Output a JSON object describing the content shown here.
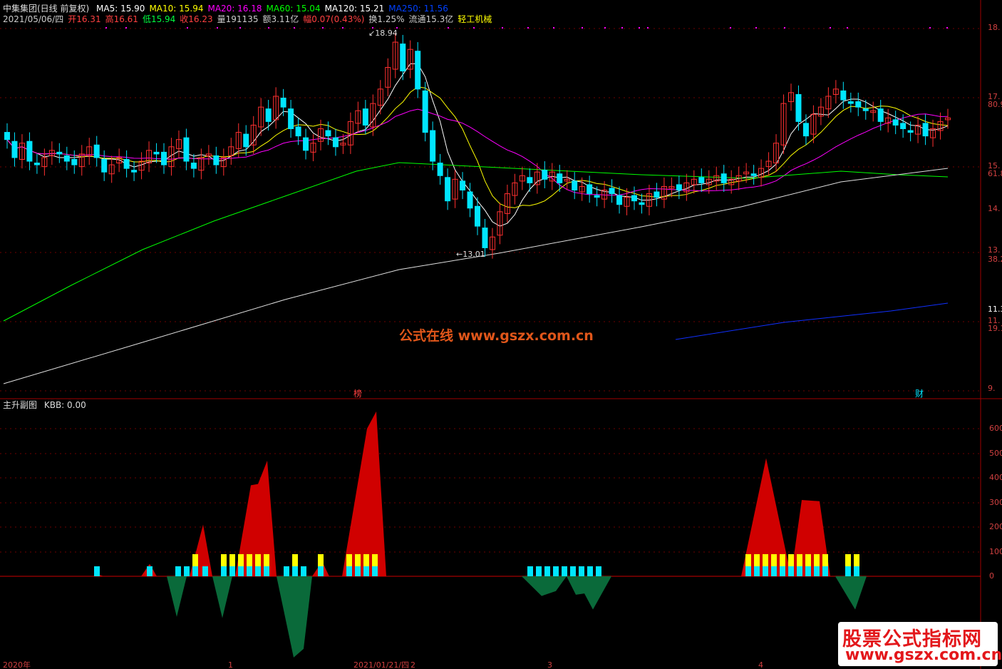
{
  "header": {
    "stock": "中集集团(日线 前复权)",
    "ma_labels": [
      {
        "text": "MA5: 15.90",
        "color": "#ffffff"
      },
      {
        "text": "MA10: 15.94",
        "color": "#ffff00"
      },
      {
        "text": "MA20: 16.18",
        "color": "#ff00ff"
      },
      {
        "text": "MA60: 15.04",
        "color": "#00ff00"
      },
      {
        "text": "MA120: 15.21",
        "color": "#ffffff"
      },
      {
        "text": "MA250: 11.56",
        "color": "#0040ff"
      }
    ]
  },
  "info": [
    {
      "text": "2021/05/06/四",
      "color": "#cccccc"
    },
    {
      "text": "开16.31",
      "color": "#ff4040"
    },
    {
      "text": "高16.61",
      "color": "#ff4040"
    },
    {
      "text": "低15.94",
      "color": "#00ff40"
    },
    {
      "text": "收16.23",
      "color": "#ff4040"
    },
    {
      "text": "量191135",
      "color": "#cccccc"
    },
    {
      "text": "额3.11亿",
      "color": "#cccccc"
    },
    {
      "text": "幅0.07(0.43%)",
      "color": "#ff4040"
    },
    {
      "text": "换1.25%",
      "color": "#cccccc"
    },
    {
      "text": "流通15.3亿",
      "color": "#cccccc"
    },
    {
      "text": "轻工机械",
      "color": "#ffff00"
    }
  ],
  "sub_header": {
    "title": "主升副图",
    "kbb": "KBB: 0.00"
  },
  "price_axis": [
    "18.",
    "17.",
    "80.9",
    "15.",
    "61.8",
    "14.",
    "13.",
    "38.2",
    "11.34",
    "11.",
    "19.1",
    "9."
  ],
  "sub_axis": [
    "600",
    "500",
    "400",
    "300",
    "200",
    "100",
    "0"
  ],
  "annotations": {
    "high": "18.94",
    "low": "13.01"
  },
  "bottom_axis": [
    "2020年",
    "1",
    "2021/01/21/四",
    "2",
    "3",
    "4"
  ],
  "markers": [
    "榜",
    "财"
  ],
  "watermark": "公式在线  www.gszx.com.cn",
  "brand": {
    "line1": "股票公式指标网",
    "line2": "www.gszx.com.cn"
  },
  "colors": {
    "up": "#ff3030",
    "down": "#00e5ff",
    "ma5": "#ffffff",
    "ma10": "#ffff00",
    "ma20": "#ff00ff",
    "ma60": "#00ff00",
    "ma120": "#e0e0e0",
    "ma250": "#1030ff",
    "area_up": "#d00000",
    "area_down": "#0a6a3a"
  },
  "chart_data": {
    "type": "candlestick",
    "price_high": 18.94,
    "price_low": 13.01,
    "last": {
      "open": 16.31,
      "high": 16.61,
      "low": 15.94,
      "close": 16.23
    }
  }
}
